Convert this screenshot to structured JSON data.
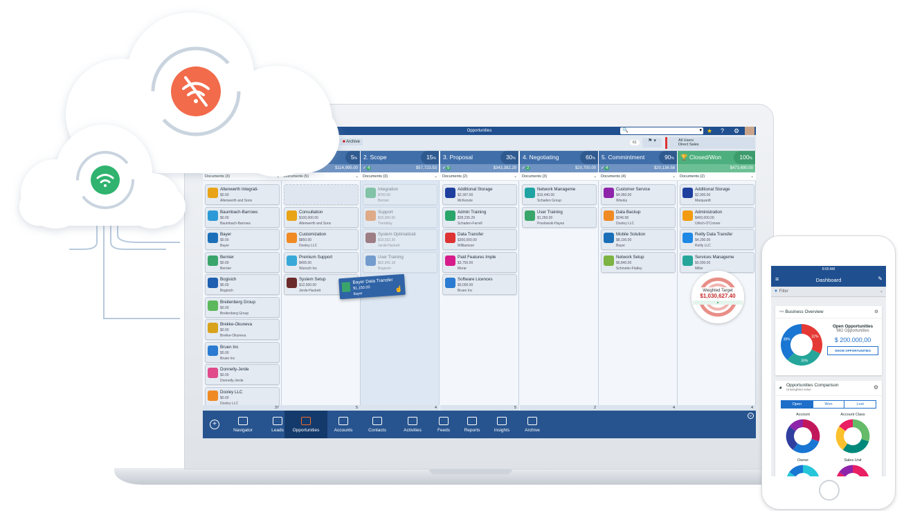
{
  "window": {
    "title": "Opportunities"
  },
  "toolbar": {
    "archive_label": "Archive",
    "count": "61",
    "users_line1": "All Users",
    "users_line2": "Direct Sales"
  },
  "colors": {
    "titlebar": "#1f4f8f",
    "column_header": "#3f6ea9",
    "closed_won": "#4caf7d",
    "nav": "#27548f",
    "weighted": "#c62828"
  },
  "columns": [
    {
      "name": "",
      "percent": "",
      "check": "",
      "amount": "",
      "docs": "Documents (3)",
      "footer": "37",
      "faded": false,
      "cards": [
        [
          "Altenwerth Integrati-",
          "$0.00",
          "Altenwerth and Sons",
          "#e8a317"
        ],
        [
          "Baumbach-Barrows",
          "$0.00",
          "Baumbach-Barrows",
          "#2c9ad6"
        ],
        [
          "Bayer",
          "$0.00",
          "Bayer",
          "#1b6fb8"
        ],
        [
          "Bernier",
          "$0.00",
          "Bernier",
          "#3aa56a"
        ],
        [
          "Bogisich",
          "$0.00",
          "Bogisich",
          "#1f5fb0"
        ],
        [
          "Breitenberg Group",
          "$0.00",
          "Breitenberg Group",
          "#5cb85c"
        ],
        [
          "Brekke-Okuneva",
          "$0.00",
          "Brekke-Okuneva",
          "#d9a21b"
        ],
        [
          "Bruen Inc",
          "$0.00",
          "Bruen Inc",
          "#2a7bd1"
        ],
        [
          "Donnelly-Jerde",
          "$0.00",
          "Donnelly-Jerde",
          "#e04a8a"
        ],
        [
          "Dooley LLC",
          "$0.00",
          "Dooley LLC",
          "#f08a24"
        ]
      ]
    },
    {
      "name": "",
      "percent": "5",
      "check": "",
      "amount": "$114,995.00",
      "docs": "Documents (5)",
      "footer": "5",
      "faded": false,
      "placeholder": true,
      "cards": [
        [
          "Consultation",
          "$100,000.00",
          "Altenwerth and Sons",
          "#e8a317"
        ],
        [
          "Customization",
          "$850.00",
          "Dooley LLC",
          "#f08a24"
        ],
        [
          "Premium Support",
          "$495.00",
          "Wunsch Inc",
          "#38a8d8"
        ],
        [
          "System Setup",
          "$12,500.00",
          "Jerde-Hackett",
          "#6b2a2a"
        ]
      ]
    },
    {
      "name": "2. Scope",
      "percent": "15",
      "check": "4",
      "amount": "$57,723.53",
      "docs": "Documents (3)",
      "footer": "4",
      "faded": true,
      "cards": [
        [
          "Integration",
          "$750.00",
          "Bernier",
          "#3aa56a"
        ],
        [
          "Support",
          "$15,000.00",
          "Tremblay",
          "#e07a2f"
        ],
        [
          "System Optimalizati",
          "$19,032.35",
          "Jerde-Hackett",
          "#6b2a2a"
        ],
        [
          "User Training",
          "$22,941.18",
          "Bogisich",
          "#1f5fb0"
        ]
      ]
    },
    {
      "name": "3. Proposal",
      "percent": "30",
      "check": "5",
      "amount": "$343,382.29",
      "docs": "Documents (2)",
      "footer": "5",
      "faded": false,
      "cards": [
        [
          "Additional Storage",
          "$2,397.00",
          "McKenzie",
          "#1f3f9f"
        ],
        [
          "Admin Training",
          "$28,235.29",
          "Schaden-Farrell",
          "#2aa56a"
        ],
        [
          "Data Transfer",
          "$300,000.00",
          "Williamson",
          "#d33"
        ],
        [
          "Paid Features Imple",
          "$3,750.00",
          "Morar",
          "#d81b8a"
        ],
        [
          "Software Licences",
          "$9,000.00",
          "Bruen Inc",
          "#2a7bd1"
        ]
      ]
    },
    {
      "name": "4. Negotiating",
      "percent": "60",
      "check": "2",
      "amount": "$20,700.00",
      "docs": "Documents (3)",
      "footer": "2",
      "faded": false,
      "cards": [
        [
          "Network Manageme",
          "$19,440.00",
          "Schaden Group",
          "#1fa3a3"
        ],
        [
          "User Training",
          "$1,260.00",
          "Powlowski-Hayes",
          "#3aa56a"
        ]
      ]
    },
    {
      "name": "5. Commintment",
      "percent": "90",
      "check": "4",
      "amount": "$20,136.58",
      "docs": "Documents (4)",
      "footer": "4",
      "faded": false,
      "cards": [
        [
          "Customer Service",
          "$4,950.00",
          "Wisoky",
          "#8e24aa"
        ],
        [
          "Data Backup",
          "$246.58",
          "Dooley LLC",
          "#f08a24"
        ],
        [
          "Mobile Solution",
          "$8,100.00",
          "Bayer",
          "#1b6fb8"
        ],
        [
          "Network Setup",
          "$6,840.00",
          "Schmeler-Flatley",
          "#7cb342"
        ]
      ]
    },
    {
      "name": "Closed/Won",
      "percent": "100",
      "check": "",
      "amount": "$473,690.00",
      "docs": "Documents (2)",
      "footer": "4",
      "faded": false,
      "won": true,
      "cards": [
        [
          "Additional Storage",
          "$2,900.00",
          "Marquardt",
          "#1f3f9f"
        ],
        [
          "Administration",
          "$400,000.00",
          "Ullrich-O'Conner",
          "#f39c12"
        ],
        [
          "Reilly Data Transfer",
          "$4,290.00",
          "Reilly LLC",
          "#1e88e5"
        ],
        [
          "Services Manageme",
          "$9,000.00",
          "Miller",
          "#26a69a"
        ]
      ]
    }
  ],
  "dragged_card": {
    "title": "Bayer Data Transfer",
    "value": "$1,150.00",
    "company": "Bayer"
  },
  "weighted_target": {
    "label": "Weighted Target",
    "value": "$1,030,627.40"
  },
  "nav": [
    "Navigator",
    "Leads",
    "Opportunities",
    "Accounts",
    "Contacts",
    "Activities",
    "Feeds",
    "Reports",
    "Insights",
    "Archive"
  ],
  "nav_active": "Opportunities",
  "phone": {
    "time": "8:00 AM",
    "title": "Dashboard",
    "filter": "Filter",
    "overview": {
      "title": "Business Overview",
      "heading": "Open Opportunities",
      "count": "982 Opportunities",
      "amount": "$ 200.000,00",
      "button": "SHOW OPPORTUNITIES",
      "slices": [
        {
          "label": "32%",
          "value": 32,
          "color": "#e53935"
        },
        {
          "label": "30%",
          "value": 30,
          "color": "#26a69a"
        },
        {
          "label": "38%",
          "value": 38,
          "color": "#1976d2"
        }
      ]
    },
    "comparison": {
      "title": "Opportunities Comparison",
      "subtitle": "Unweighted value",
      "tabs": [
        "Open",
        "Won",
        "Lost"
      ],
      "active_tab": "Open",
      "charts": [
        "Account",
        "Account Class",
        "Owner",
        "Sales Unit"
      ]
    }
  }
}
